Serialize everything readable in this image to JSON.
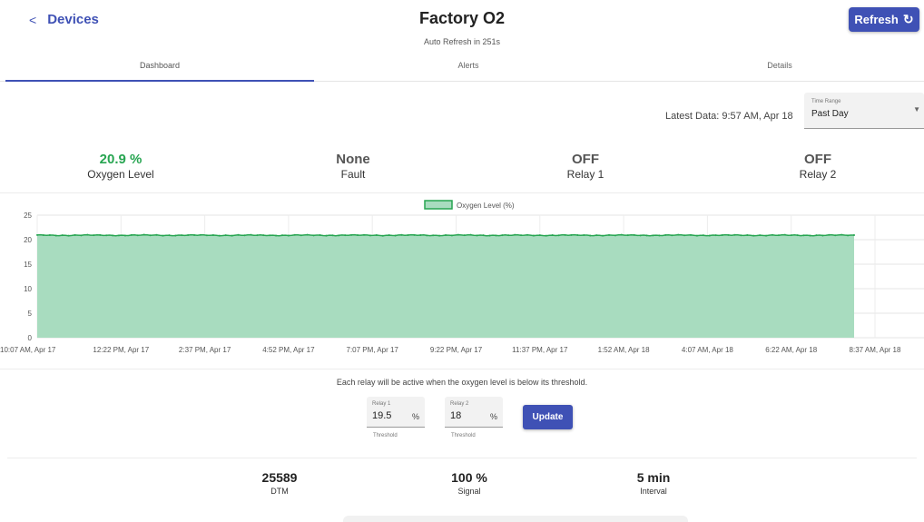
{
  "header": {
    "back_label": "Devices",
    "title": "Factory O2",
    "subtitle": "Auto Refresh in 251s",
    "refresh_label": "Refresh"
  },
  "tabs": [
    {
      "label": "Dashboard",
      "active": true
    },
    {
      "label": "Alerts",
      "active": false
    },
    {
      "label": "Details",
      "active": false
    }
  ],
  "latest_data": "Latest Data: 9:57 AM, Apr 18",
  "time_range": {
    "label": "Time Range",
    "value": "Past Day"
  },
  "stats": [
    {
      "value": "20.9 %",
      "label": "Oxygen Level",
      "color": "#27a551"
    },
    {
      "value": "None",
      "label": "Fault",
      "color": "#555555"
    },
    {
      "value": "OFF",
      "label": "Relay 1",
      "color": "#555555"
    },
    {
      "value": "OFF",
      "label": "Relay 2",
      "color": "#555555"
    }
  ],
  "chart_data": {
    "type": "area",
    "legend": "Oxygen Level (%)",
    "legend_position": "top-center",
    "grid": true,
    "ylim": [
      0,
      25
    ],
    "yticks": [
      0,
      5,
      10,
      15,
      20,
      25
    ],
    "x_ticks": [
      "10:07 AM, Apr 17",
      "12:22 PM, Apr 17",
      "2:37 PM, Apr 17",
      "4:52 PM, Apr 17",
      "7:07 PM, Apr 17",
      "9:22 PM, Apr 17",
      "11:37 PM, Apr 17",
      "1:52 AM, Apr 18",
      "4:07 AM, Apr 18",
      "6:22 AM, Apr 18",
      "8:37 AM, Apr 18"
    ],
    "series": [
      {
        "name": "Oxygen Level (%)",
        "color": "#27a551",
        "fill": "#a8dcbf",
        "value_approx": 20.9
      }
    ]
  },
  "thresholds": {
    "note": "Each relay will be active when the oxygen level is below its threshold.",
    "relay1": {
      "label": "Relay 1",
      "value": "19.5",
      "unit": "%",
      "help": "Threshold"
    },
    "relay2": {
      "label": "Relay 2",
      "value": "18",
      "unit": "%",
      "help": "Threshold"
    },
    "update_label": "Update"
  },
  "metrics": [
    {
      "value": "25589",
      "label": "DTM"
    },
    {
      "value": "100 %",
      "label": "Signal"
    },
    {
      "value": "5 min",
      "label": "Interval"
    }
  ]
}
